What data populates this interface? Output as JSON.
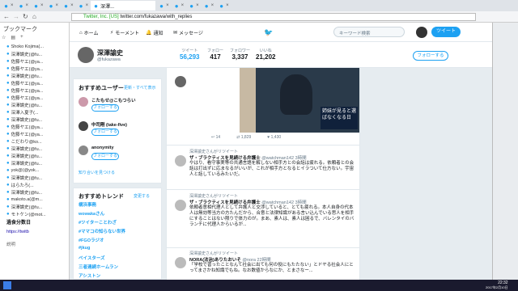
{
  "browser": {
    "url": "twitter.com/fukazawa/with_replies",
    "url_prefix": "Twitter, Inc. [US]",
    "active_tab": "深澤..."
  },
  "bookmarks": {
    "title": "ブックマーク",
    "items": [
      "Shoko Kojima(...",
      "深澤論史(@fu...",
      "佐藤ヤエ(@ya...",
      "佐藤ヤエ(@ya...",
      "深澤論史(@fu...",
      "佐藤ヤエ(@ya...",
      "佐藤ヤエ(@ya...",
      "佐藤ヤエ(@ya...",
      "深澤論史(@fu...",
      "深澤入夏子(...",
      "深澤論史(@fu...",
      "佐藤ヤエ(@ya...",
      "佐藤ヤエ(@ya...",
      "こだわり@ko...",
      "深澤論史(@fu...",
      "深澤論史(@fu...",
      "深澤論史(@fu...",
      "yok@(@yok...",
      "深澤論史(@fu...",
      "はらたろ(...",
      "深澤論史(@fu...",
      "makoto.a(@m...",
      "深澤論史(@fu...",
      "モトケン(@mot..."
    ],
    "footer_title": "過食分数日",
    "footer_link": "https://twitb",
    "footer_desc": "説明"
  },
  "nav": {
    "home": "ホーム",
    "moments": "モーメント",
    "notifications": "通知",
    "messages": "メッセージ",
    "search_placeholder": "キーワード検索",
    "tweet": "ツイート"
  },
  "profile": {
    "name": "深澤諭史",
    "handle": "@fukazawa",
    "stats": [
      {
        "label": "ツイート",
        "value": "56,293"
      },
      {
        "label": "フォロー",
        "value": "417"
      },
      {
        "label": "フォロワー",
        "value": "3,337"
      },
      {
        "label": "いいね",
        "value": "21,202"
      }
    ],
    "follow": "フォローする"
  },
  "suggest": {
    "title": "おすすめユーザー",
    "refresh": "更新・すべて表示",
    "users": [
      {
        "name": "こたもせ@こもつらい",
        "handle": "@kota..",
        "btn": "フォローする"
      },
      {
        "name": "中司剛 (take-five)",
        "handle": "@ta..",
        "btn": "フォローする"
      },
      {
        "name": "anonymity",
        "handle": "@jane0101",
        "btn": "フォローする"
      }
    ],
    "find": "知り合いを見つける"
  },
  "trends": {
    "title": "おすすめトレンド",
    "change": "変更する",
    "items": [
      "構浜事務",
      "wowakaさん",
      "#ツイターことわざ",
      "#ママコの知らない世界",
      "#FGOラジオ",
      "#jkug",
      "ベイスターズ",
      "三者連続ホームラン",
      "アシストン"
    ]
  },
  "feed": {
    "tweet_counts": {
      "reply": "14",
      "rt": "1,829",
      "like": "1,430"
    },
    "image_caption": "姉妹が見ると選ばなくなる日",
    "retweet_label": "深澤諭史さんがリツイート",
    "t1": {
      "name": "ザ・ブラクティスを見続ける弁護士",
      "handle": "@watchman142",
      "time": "3時間",
      "text": "やはり、看守事実等の共通言語を解しない相手方との会話は疲れる。依頼者との会話は打出ずに応まなるがいいが、これが相手方となるとイラついて仕方ない。宇宙人と話しているみたいだ。"
    },
    "t2": {
      "name": "ザ・ブラクティスを見続ける弁護士",
      "handle": "@watchman142",
      "time": "3時間",
      "text": "依頼者意相代理人として弁護人と交渉していると、とても疲れる。本人自身の代本人は無効等当方の方たんだから、合意と法律知識がある言い込んでいる思人を相手にすることはない限りで体力のが。まあ、素人は、素人は困るで、バレンタイのバランチに代理人からいるが..."
    },
    "t3": {
      "name": "NORA(法治)ありたおいそ",
      "handle": "@nora",
      "time": "22時間",
      "text": "「学校で習ったことなんて社会に出ても何の役にもたたない」とドヤる社会人にとってまさかね知識でもね。なお数値からなにか、とまさなー..."
    }
  },
  "taskbar": {
    "time": "22:32",
    "date": "2017年2月10日"
  }
}
